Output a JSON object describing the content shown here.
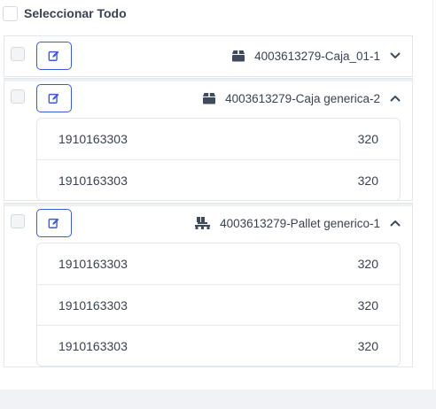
{
  "select_all": {
    "label": "Seleccionar Todo"
  },
  "groups": [
    {
      "title": "4003613279-Caja_01-1",
      "type_icon": "box-icon",
      "expanded": false,
      "items": []
    },
    {
      "title": "4003613279-Caja generica-2",
      "type_icon": "box-icon",
      "expanded": true,
      "items": [
        {
          "code": "1910163303",
          "qty": "320"
        },
        {
          "code": "1910163303",
          "qty": "320"
        }
      ]
    },
    {
      "title": "4003613279-Pallet generico-1",
      "type_icon": "pallet-icon",
      "expanded": true,
      "items": [
        {
          "code": "1910163303",
          "qty": "320"
        },
        {
          "code": "1910163303",
          "qty": "320"
        },
        {
          "code": "1910163303",
          "qty": "320"
        }
      ]
    }
  ],
  "colors": {
    "accent": "#3b5bdb",
    "icon": "#3f4a5c",
    "border": "#e3e6eb"
  }
}
